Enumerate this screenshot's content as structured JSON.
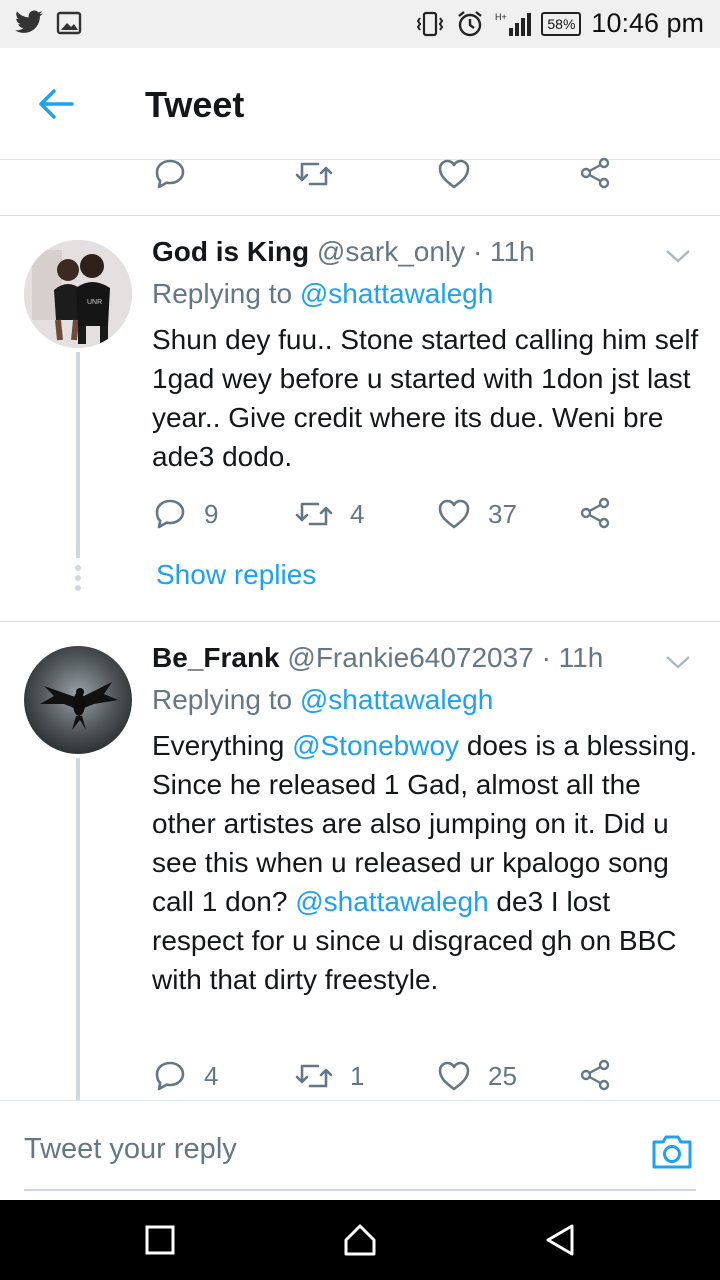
{
  "status_bar": {
    "time": "10:46 pm",
    "battery": "58%",
    "left_icons": [
      "twitter-bird-icon",
      "image-icon"
    ],
    "right_icons": [
      "vibrate-icon",
      "alarm-icon",
      "signal-icon",
      "battery-icon"
    ]
  },
  "header": {
    "title": "Tweet",
    "back_icon": "arrow-left-icon"
  },
  "top_actions": {
    "reply_count": "",
    "retweet_count": "",
    "like_count": ""
  },
  "tweets": [
    {
      "display_name": "God is King",
      "handle": "@sark_only",
      "time": "· 11h",
      "replying_prefix": "Replying to",
      "replying_to": "@shattawalegh",
      "body": "Shun dey fuu.. Stone started calling him self 1gad wey before u started with 1don jst last year.. Give credit where its due. Weni bre ade3 dodo.",
      "reply_count": "9",
      "retweet_count": "4",
      "like_count": "37",
      "show_replies": "Show replies"
    },
    {
      "display_name": "Be_Frank",
      "handle": "@Frankie64072037",
      "time": "· 11h",
      "replying_prefix": "Replying to",
      "replying_to": "@shattawalegh",
      "body_parts": {
        "p1": "Everything ",
        "m1": "@Stonebwoy",
        "p2": " does is a blessing. Since he released 1 Gad, almost all the other artistes are also jumping on it. Did u see this when u released ur kpalogo song call 1 don? ",
        "m2": "@shattawalegh",
        "p3": " de3 I lost respect for u since u disgraced gh on BBC with that dirty freestyle."
      },
      "reply_count": "4",
      "retweet_count": "1",
      "like_count": "25"
    }
  ],
  "composer": {
    "placeholder": "Tweet your reply",
    "camera_icon": "camera-icon"
  },
  "colors": {
    "accent": "#1da1f2",
    "text": "#14171a",
    "muted": "#657786"
  }
}
